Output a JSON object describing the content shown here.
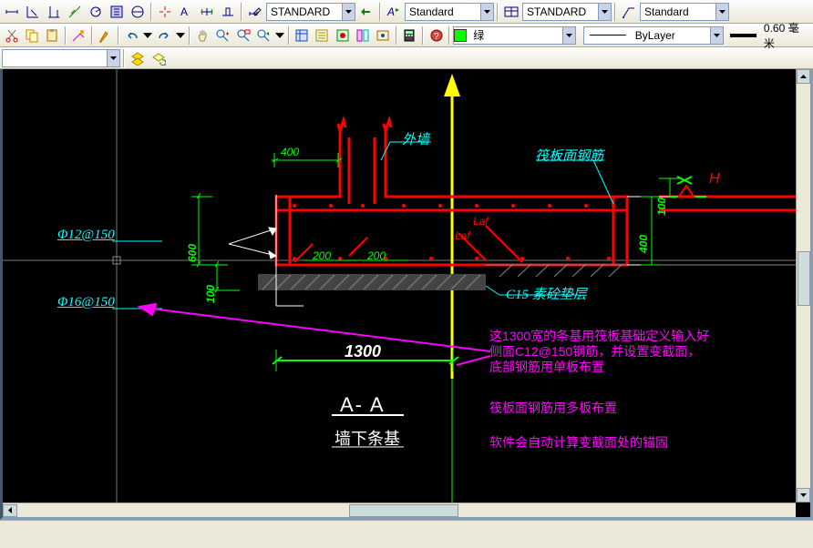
{
  "toolbar1": {
    "style1": "STANDARD",
    "style2": "Standard",
    "style3": "STANDARD",
    "style4": "Standard"
  },
  "toolbar2": {
    "color": "绿",
    "linetype": "ByLayer",
    "lineweight": "0.60 毫米"
  },
  "drawing": {
    "label_wall": "外墙",
    "label_raft": "筏板面钢筋",
    "label_H": "H",
    "label_c15": "C15 素砼垫层",
    "dim_400": "400",
    "dim_600": "600",
    "dim_100": "100",
    "dim_400r": "400",
    "dim_100r": "100",
    "dim_200a": "200",
    "dim_200b": "200",
    "dim_1300": "1300",
    "label_laf1": "Laf",
    "label_laf2": "Laf",
    "rebar1": "Φ12@150",
    "rebar2": "Φ16@150",
    "section": "A- A",
    "subtitle": "墙下条基",
    "note1": "这1300宽的条基用筏板基础定义输入好",
    "note2": "侧面C12@150钢筋，并设置变截面，",
    "note3": "底部钢筋用单板布置",
    "note4": "筏板面钢筋用多板布置",
    "note5": "软件会自动计算变截面处的锚固"
  }
}
